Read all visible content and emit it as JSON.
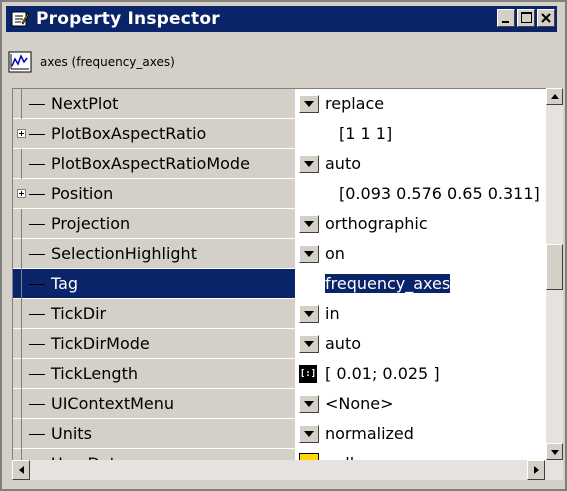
{
  "window": {
    "title": "Property Inspector",
    "controls": [
      "minimize-icon",
      "maximize-icon",
      "close-icon"
    ]
  },
  "object": {
    "label": "axes (frequency_axes)",
    "icon": "axes-plot-icon"
  },
  "properties": [
    {
      "name": "NextPlot",
      "value": "replace",
      "control": "dropdown",
      "expandable": false
    },
    {
      "name": "PlotBoxAspectRatio",
      "value": "[1 1 1]",
      "control": "none",
      "expandable": true
    },
    {
      "name": "PlotBoxAspectRatioMode",
      "value": "auto",
      "control": "dropdown",
      "expandable": false
    },
    {
      "name": "Position",
      "value": "[0.093 0.576 0.65 0.311]",
      "control": "none",
      "expandable": true
    },
    {
      "name": "Projection",
      "value": "orthographic",
      "control": "dropdown",
      "expandable": false
    },
    {
      "name": "SelectionHighlight",
      "value": "on",
      "control": "dropdown",
      "expandable": false
    },
    {
      "name": "Tag",
      "value": "frequency_axes",
      "control": "text",
      "expandable": false,
      "selected": true
    },
    {
      "name": "TickDir",
      "value": "in",
      "control": "dropdown",
      "expandable": false
    },
    {
      "name": "TickDirMode",
      "value": "auto",
      "control": "dropdown",
      "expandable": false
    },
    {
      "name": "TickLength",
      "value": "[ 0.01; 0.025 ]",
      "control": "array-editor",
      "expandable": false
    },
    {
      "name": "UIContextMenu",
      "value": "<None>",
      "control": "dropdown",
      "expandable": false
    },
    {
      "name": "Units",
      "value": "normalized",
      "control": "dropdown",
      "expandable": false
    },
    {
      "name": "UserData",
      "value": "null",
      "control": "strip-editor",
      "expandable": false
    }
  ],
  "colors": {
    "titlebar": "#0a246a",
    "selection": "#0a246a",
    "chrome": "#d4d0c8"
  }
}
